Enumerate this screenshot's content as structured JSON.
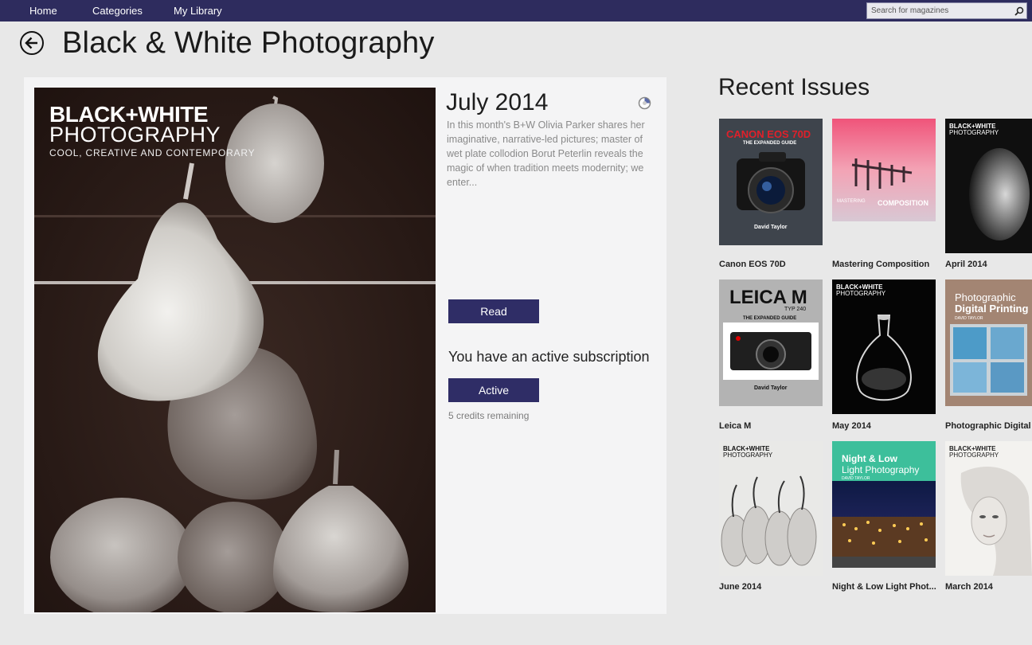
{
  "nav": {
    "items": [
      {
        "label": "Home"
      },
      {
        "label": "Categories"
      },
      {
        "label": "My Library"
      }
    ],
    "search_placeholder": "Search for magazines",
    "search_icon": "search-icon"
  },
  "header": {
    "back_icon": "arrow-left-icon",
    "title": "Black & White Photography"
  },
  "issue": {
    "title": "July 2014",
    "description": "In this month's B+W Olivia Parker shares her imaginative, narrative-led pictures; master of wet plate collodion Borut Peterlin reveals the magic of when tradition meets modernity; we enter...",
    "read_label": "Read",
    "subscription_status": "You have an active subscription",
    "active_label": "Active",
    "credits": "5 credits remaining",
    "cover": {
      "mast_line1": "BLACK+WHITE",
      "mast_line2": "PHOTOGRAPHY",
      "mast_line3": "COOL, CREATIVE AND CONTEMPORARY"
    }
  },
  "recent": {
    "heading": "Recent Issues",
    "items": [
      {
        "label": "Canon EOS 70D",
        "cover_title": "CANON EOS 70D",
        "cover_sub": "THE EXPANDED GUIDE",
        "cover_author": "David Taylor"
      },
      {
        "label": "Mastering Composition",
        "cover_title": "COMPOSITION",
        "cover_sub": "MASTERING"
      },
      {
        "label": "April 2014",
        "cover_title": "BLACK+WHITE",
        "cover_sub": "PHOTOGRAPHY"
      },
      {
        "label": "Leica M",
        "cover_title": "LEICA M",
        "cover_sub": "TYP 240",
        "cover_sub2": "THE EXPANDED GUIDE",
        "cover_author": "David Taylor"
      },
      {
        "label": "May 2014",
        "cover_title": "BLACK+WHITE",
        "cover_sub": "PHOTOGRAPHY"
      },
      {
        "label": "Photographic Digital P",
        "cover_title": "Photographic",
        "cover_sub": "Digital Printing",
        "cover_author": "DAVID TAYLOR"
      },
      {
        "label": "June 2014",
        "cover_title": "BLACK+WHITE",
        "cover_sub": "PHOTOGRAPHY"
      },
      {
        "label": "Night & Low Light Phot...",
        "cover_title": "Night & Low",
        "cover_sub": "Light Photography",
        "cover_author": "DAVID TAYLOR"
      },
      {
        "label": "March 2014",
        "cover_title": "BLACK+WHITE",
        "cover_sub": "PHOTOGRAPHY"
      }
    ]
  },
  "colors": {
    "nav_bg": "#2e2c5e",
    "button_bg": "#2f2d66",
    "canon_red": "#e0202a",
    "digital_printing_brown": "#a38573",
    "night_teal": "#3dbf9b"
  }
}
